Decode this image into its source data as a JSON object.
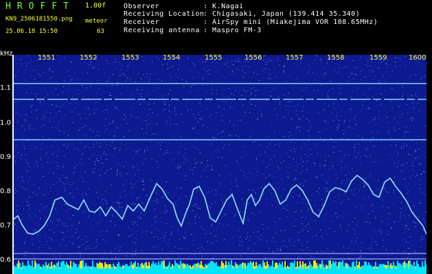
{
  "header": {
    "logo": "HROFFT",
    "version": "1.00f",
    "filename": "KN9_2506181550.png",
    "datetime": "25.06.18 15:50",
    "meteor_label": "meteor",
    "meteor_count": "63",
    "fields": [
      {
        "label": "Observer",
        "value": ": K.Nagai"
      },
      {
        "label": "Receiving Location",
        "value": ": Chigasaki, Japan (139.414 35.340)"
      },
      {
        "label": "Receiver",
        "value": ": AirSpy mini (Miakejima VOR 108.65MHz)"
      },
      {
        "label": "Receiving antenna",
        "value": ": Maspro FM-3"
      }
    ]
  },
  "spectrogram": {
    "y_unit": "kHz",
    "y_ticks": [
      "1.1",
      "1.0",
      "0.9",
      "0.8",
      "0.7",
      "0.6"
    ],
    "x_ticks": [
      "1551",
      "1552",
      "1553",
      "1554",
      "1555",
      "1556",
      "1557",
      "1558",
      "1559",
      "1600"
    ],
    "colors": {
      "background": "#0d1a8f",
      "trace": "#8fe8ff",
      "carrier": "#7fd8ff",
      "tick": "#ffff33"
    }
  }
}
